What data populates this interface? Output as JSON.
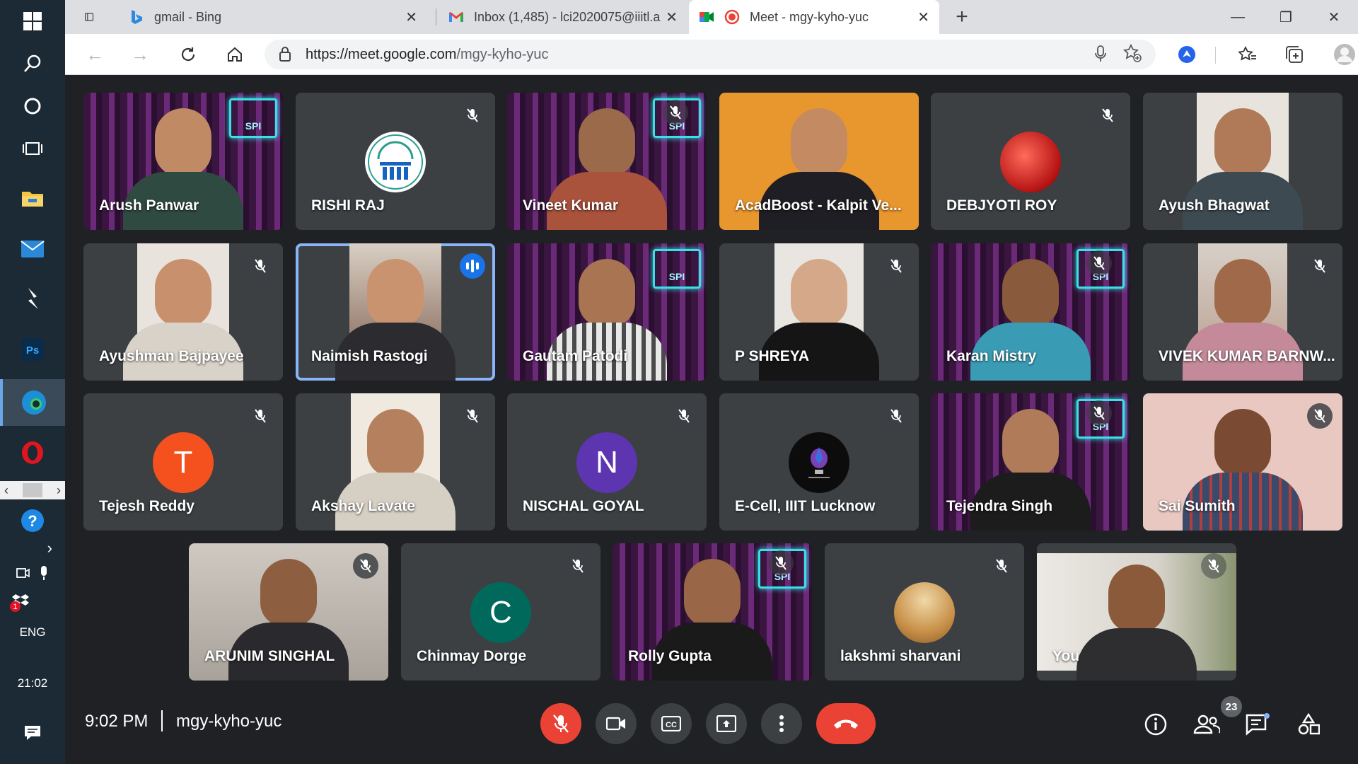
{
  "browser": {
    "tabs": [
      {
        "title": "gmail - Bing",
        "icon": "bing-icon"
      },
      {
        "title": "Inbox (1,485) - lci2020075@iiitl.a",
        "icon": "gmail-icon"
      },
      {
        "title": "Meet - mgy-kyho-yuc",
        "icon": "meet-icon"
      }
    ],
    "url_host": "https://meet.google.com",
    "url_path": "/mgy-kyho-yuc"
  },
  "taskbar": {
    "language": "ENG",
    "clock": "21:02",
    "notification_badge": "1"
  },
  "participants": [
    {
      "name": "Arush Panwar",
      "muted": false,
      "type": "video"
    },
    {
      "name": "RISHI RAJ",
      "muted": true,
      "type": "avatar-logo"
    },
    {
      "name": "Vineet Kumar",
      "muted": true,
      "type": "video"
    },
    {
      "name": "AcadBoost - Kalpit Ve...",
      "muted": false,
      "type": "video"
    },
    {
      "name": "DEBJYOTI ROY",
      "muted": true,
      "type": "avatar-photo"
    },
    {
      "name": "Ayush Bhagwat",
      "muted": false,
      "type": "video"
    },
    {
      "name": "Ayushman Bajpayee",
      "muted": true,
      "type": "video"
    },
    {
      "name": "Naimish Rastogi",
      "muted": false,
      "type": "video",
      "speaking": true
    },
    {
      "name": "Gautam Patodi",
      "muted": false,
      "type": "video"
    },
    {
      "name": "P SHREYA",
      "muted": true,
      "type": "video"
    },
    {
      "name": "Karan Mistry",
      "muted": true,
      "type": "video"
    },
    {
      "name": "VIVEK KUMAR BARNW...",
      "muted": true,
      "type": "video"
    },
    {
      "name": "Tejesh Reddy",
      "muted": true,
      "type": "letter",
      "letter": "T",
      "color": "#f4511e"
    },
    {
      "name": "Akshay Lavate",
      "muted": true,
      "type": "video"
    },
    {
      "name": "NISCHAL GOYAL",
      "muted": true,
      "type": "letter",
      "letter": "N",
      "color": "#5e35b1"
    },
    {
      "name": "E-Cell, IIIT Lucknow",
      "muted": true,
      "type": "avatar-logo-dark"
    },
    {
      "name": "Tejendra Singh",
      "muted": true,
      "type": "video"
    },
    {
      "name": "Sai Sumith",
      "muted": true,
      "type": "video"
    },
    {
      "name": "ARUNIM SINGHAL",
      "muted": true,
      "type": "video"
    },
    {
      "name": "Chinmay Dorge",
      "muted": true,
      "type": "letter",
      "letter": "C",
      "color": "#00695c"
    },
    {
      "name": "Rolly Gupta",
      "muted": true,
      "type": "video"
    },
    {
      "name": "lakshmi sharvani",
      "muted": true,
      "type": "avatar-photo"
    },
    {
      "name": "You",
      "muted": true,
      "type": "video"
    }
  ],
  "meeting": {
    "time": "9:02 PM",
    "separator": "|",
    "code": "mgy-kyho-yuc",
    "participant_count": "23"
  },
  "colors": {
    "meet_background": "#202124",
    "tile_background": "#3c4043",
    "end_call_red": "#ea4335",
    "speaking_blue": "#1a73e8"
  }
}
